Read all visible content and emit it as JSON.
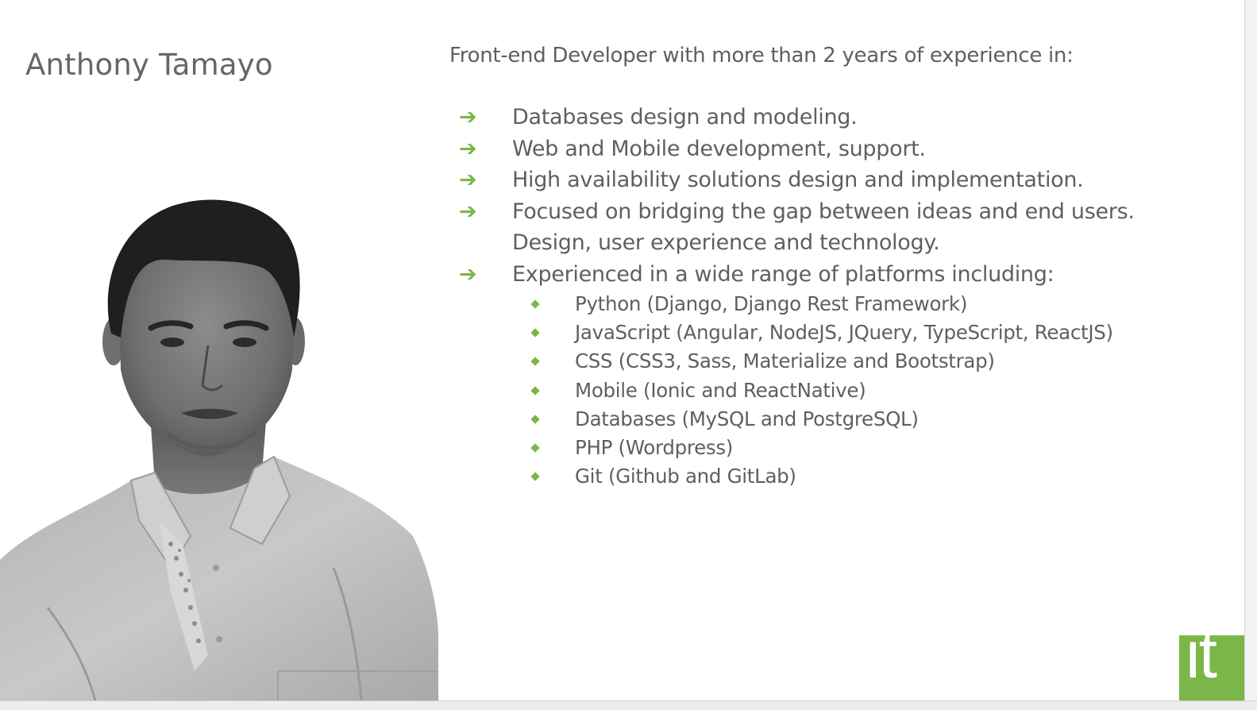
{
  "profile": {
    "name": "Anthony Tamayo",
    "intro": "Front-end Developer with more than 2 years of experience in:"
  },
  "bullets": [
    {
      "lines": [
        "Databases design and modeling."
      ]
    },
    {
      "lines": [
        "Web and Mobile development, support."
      ]
    },
    {
      "lines": [
        "High availability solutions design and implementation."
      ]
    },
    {
      "lines": [
        "Focused on bridging the gap between ideas and end users.",
        "Design, user experience and technology."
      ]
    },
    {
      "lines": [
        "Experienced in a wide range of platforms including:"
      ]
    }
  ],
  "platforms": [
    "Python (Django, Django Rest Framework)",
    "JavaScript (Angular, NodeJS, JQuery, TypeScript, ReactJS)",
    "CSS (CSS3, Sass, Materialize and Bootstrap)",
    "Mobile (Ionic and ReactNative)",
    "Databases (MySQL and PostgreSQL)",
    "PHP (Wordpress)",
    "Git (Github and GitLab)"
  ],
  "logo": {
    "text": "it"
  },
  "colors": {
    "accent": "#7ab648",
    "text": "#5f5f5f",
    "name": "#666666",
    "background": "#ffffff"
  },
  "icons": {
    "bullet": "arrow-right-icon",
    "sub_bullet": "diamond-icon"
  }
}
